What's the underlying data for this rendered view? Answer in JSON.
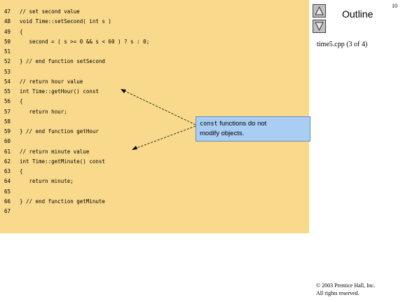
{
  "header": {
    "page_number": "10",
    "outline_title": "Outline",
    "file_label": "time5.cpp (3 of 4)"
  },
  "nav": {
    "up_icon": "triangle-up-icon",
    "down_icon": "triangle-down-icon"
  },
  "code": {
    "lines": [
      {
        "num": "47",
        "text": "// set second value"
      },
      {
        "num": "48",
        "text": "void Time::setSecond( int s )"
      },
      {
        "num": "49",
        "text": "{"
      },
      {
        "num": "50",
        "text": "   second = ( s >= 0 && s < 60 ) ? s : 0;"
      },
      {
        "num": "51",
        "text": ""
      },
      {
        "num": "52",
        "text": "} // end function setSecond"
      },
      {
        "num": "53",
        "text": ""
      },
      {
        "num": "54",
        "text": "// return hour value"
      },
      {
        "num": "55",
        "text": "int Time::getHour() const"
      },
      {
        "num": "56",
        "text": "{"
      },
      {
        "num": "57",
        "text": "   return hour;"
      },
      {
        "num": "58",
        "text": ""
      },
      {
        "num": "59",
        "text": "} // end function getHour"
      },
      {
        "num": "60",
        "text": ""
      },
      {
        "num": "61",
        "text": "// return minute value"
      },
      {
        "num": "62",
        "text": "int Time::getMinute() const"
      },
      {
        "num": "63",
        "text": "{"
      },
      {
        "num": "64",
        "text": "   return minute;"
      },
      {
        "num": "65",
        "text": ""
      },
      {
        "num": "66",
        "text": "} // end function getMinute"
      },
      {
        "num": "67",
        "text": ""
      }
    ]
  },
  "callout": {
    "keyword": "const",
    "text_after_keyword": " functions do not",
    "text_line2": "modify objects."
  },
  "footer": {
    "copyright_line1": "© 2003 Prentice Hall, Inc.",
    "copyright_line2": "All rights reserved."
  },
  "colors": {
    "code_background": "#f9d98b",
    "callout_background": "#a9cdf3"
  }
}
